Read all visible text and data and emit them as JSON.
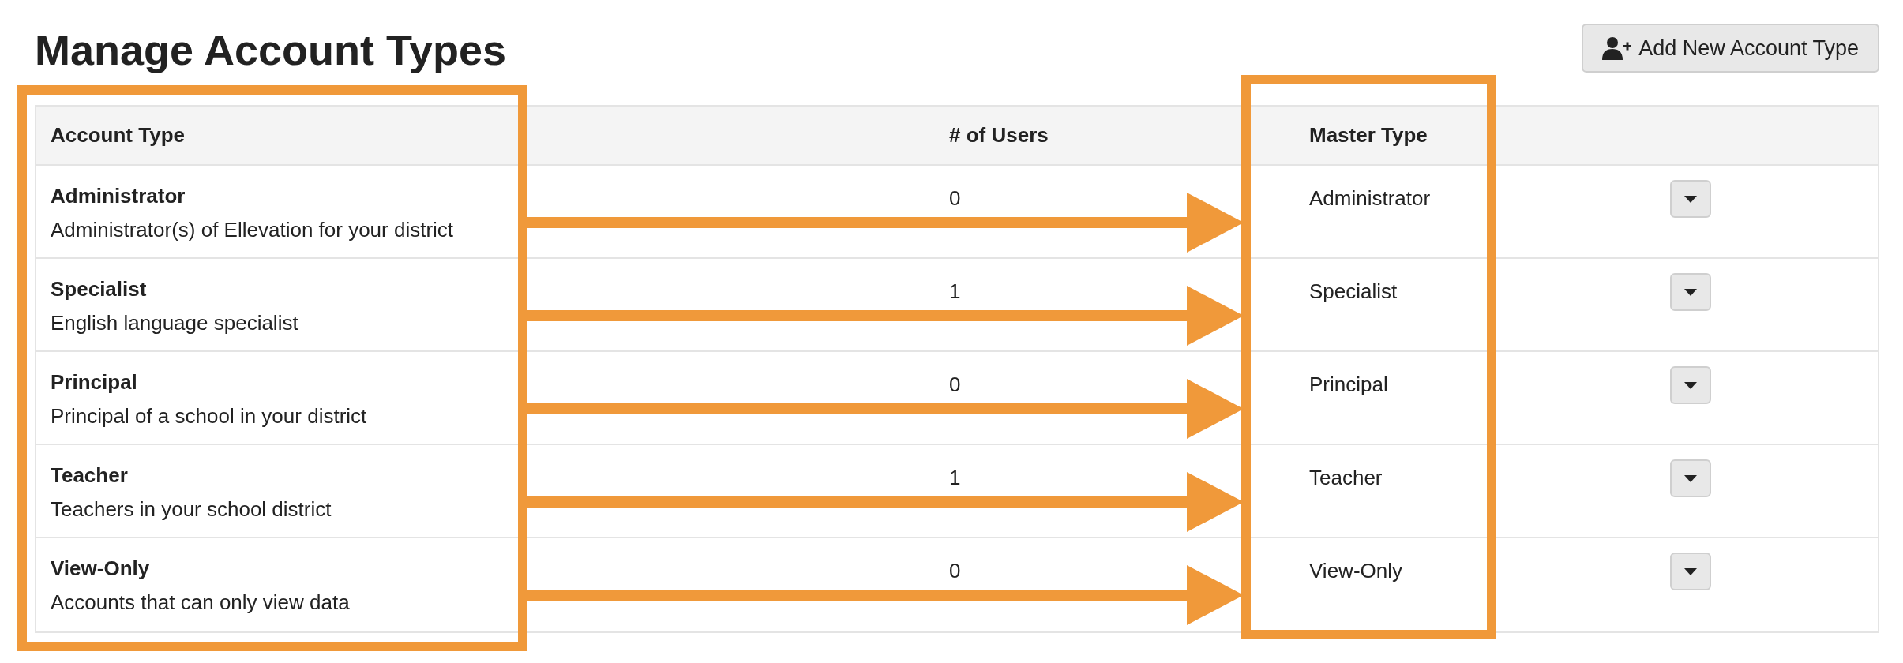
{
  "title": "Manage Account Types",
  "add_button": {
    "label": "Add New Account Type"
  },
  "table": {
    "columns": [
      "Account Type",
      "# of Users",
      "Master Type"
    ],
    "rows": [
      {
        "name": "Administrator",
        "description": "Administrator(s) of Ellevation for your district",
        "users": "0",
        "master_type": "Administrator"
      },
      {
        "name": "Specialist",
        "description": "English language specialist",
        "users": "1",
        "master_type": "Specialist"
      },
      {
        "name": "Principal",
        "description": "Principal of a school in your district",
        "users": "0",
        "master_type": "Principal"
      },
      {
        "name": "Teacher",
        "description": "Teachers in your school district",
        "users": "1",
        "master_type": "Teacher"
      },
      {
        "name": "View-Only",
        "description": "Accounts that can only view data",
        "users": "0",
        "master_type": "View-Only"
      }
    ]
  }
}
